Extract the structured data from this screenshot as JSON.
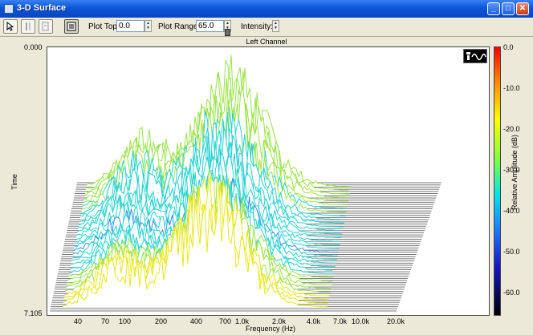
{
  "window": {
    "title": "3-D Surface"
  },
  "toolbar": {
    "plot_top_label": "Plot Top:",
    "plot_top_value": "0.0",
    "plot_range_label": "Plot Range:",
    "plot_range_value": "65.0",
    "intensity_label": "Intensity:",
    "tools": [
      "pointer-tool-icon",
      "cursor-tool-icon",
      "readout-tool-icon",
      "display-options-icon"
    ]
  },
  "plot": {
    "channel": "Left Channel",
    "y_top": "0.000",
    "y_bottom": "7.105",
    "ylabel": "Time",
    "xlabel": "Frequency (Hz)",
    "x_ticks": [
      "40",
      "70",
      "100",
      "200",
      "400",
      "700",
      "1.0k",
      "2.0k",
      "4.0k",
      "7.0k",
      "10.0k",
      "20.0k"
    ],
    "colorbar_label": "Relative Amplitude (dB)",
    "colorbar_ticks": [
      "0.0",
      "-10.0",
      "-20.0",
      "-30.0",
      "-40.0",
      "-50.0",
      "-60.0"
    ]
  }
}
